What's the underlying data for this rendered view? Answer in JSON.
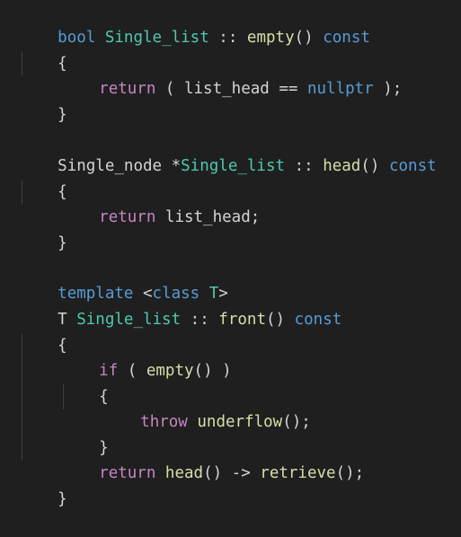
{
  "code": {
    "l1": {
      "kw_bool": "bool",
      "type": "Single_list",
      "scope": " :: ",
      "fn": "empty",
      "parens": "()",
      "kw_const": "const"
    },
    "l2": {
      "brace": "{"
    },
    "l3": {
      "kw_return": "return",
      "p1": " ( ",
      "id": "list_head",
      "op": " == ",
      "kw_nullptr": "nullptr",
      "p2": " );"
    },
    "l4": {
      "brace": "}"
    },
    "l6": {
      "type_node": "Single_node",
      "star": " *",
      "type": "Single_list",
      "scope": " :: ",
      "fn": "head",
      "parens": "()",
      "kw_const": "const"
    },
    "l7": {
      "brace": "{"
    },
    "l8": {
      "kw_return": "return",
      "id": " list_head",
      "semi": ";"
    },
    "l9": {
      "brace": "}"
    },
    "l11": {
      "kw_template": "template",
      "lt": " <",
      "kw_class": "class",
      "tparam": " T",
      "gt": ">"
    },
    "l12": {
      "tret": "T ",
      "type": "Single_list",
      "scope": " :: ",
      "fn": "front",
      "parens": "()",
      "kw_const": "const"
    },
    "l13": {
      "brace": "{"
    },
    "l14": {
      "kw_if": "if",
      "p1": " ( ",
      "fn": "empty",
      "p2": "() )"
    },
    "l15": {
      "brace": "{"
    },
    "l16": {
      "kw_throw": "throw",
      "fn": " underflow",
      "p": "();"
    },
    "l17": {
      "brace": "}"
    },
    "l18": {
      "kw_return": "return",
      "fn1": " head",
      "mid": "() -> ",
      "fn2": "retrieve",
      "end": "();"
    },
    "l19": {
      "brace": "}"
    }
  },
  "colors": {
    "background": "#1f1f1f",
    "keyword": "#569cd6",
    "control": "#c586c0",
    "type": "#4ec9b0",
    "function": "#dcdcaa",
    "identifier": "#9cdcfe",
    "text": "#d4d4d4"
  }
}
